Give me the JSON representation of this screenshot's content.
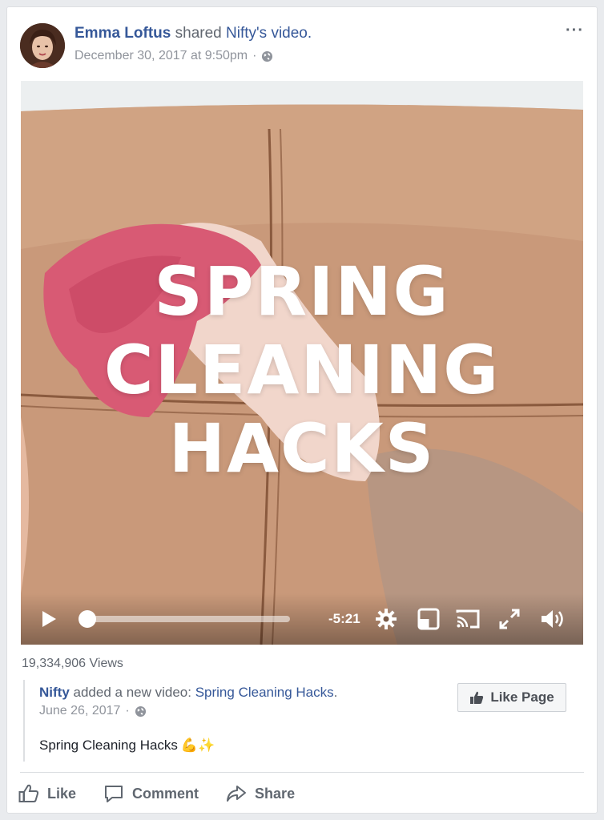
{
  "post": {
    "author": "Emma Loftus",
    "shared_text": "shared",
    "page_possessive": "Nifty",
    "video_word": "'s video.",
    "timestamp": "December 30, 2017 at 9:50pm",
    "separator": "·",
    "privacy_icon": "globe-icon",
    "more_icon": "···"
  },
  "video": {
    "title_lines": [
      "SPRING",
      "CLEANING",
      "HACKS"
    ],
    "time_remaining": "-5:21",
    "progress": 0,
    "controls": [
      "play-icon",
      "settings-icon",
      "pip-icon",
      "cast-icon",
      "fullscreen-icon",
      "volume-icon"
    ]
  },
  "stats": {
    "views": "19,334,906 Views"
  },
  "shared_post": {
    "page": "Nifty",
    "action": "added a new video:",
    "video_title": "Spring Cleaning Hacks",
    "period": ".",
    "date": "June 26, 2017",
    "separator": "·",
    "caption": "Spring Cleaning Hacks",
    "caption_emoji": "💪✨",
    "like_page_label": "Like Page"
  },
  "actions": {
    "like": "Like",
    "comment": "Comment",
    "share": "Share"
  },
  "colors": {
    "link": "#365899",
    "meta": "#90949c",
    "action_text": "#606770"
  }
}
